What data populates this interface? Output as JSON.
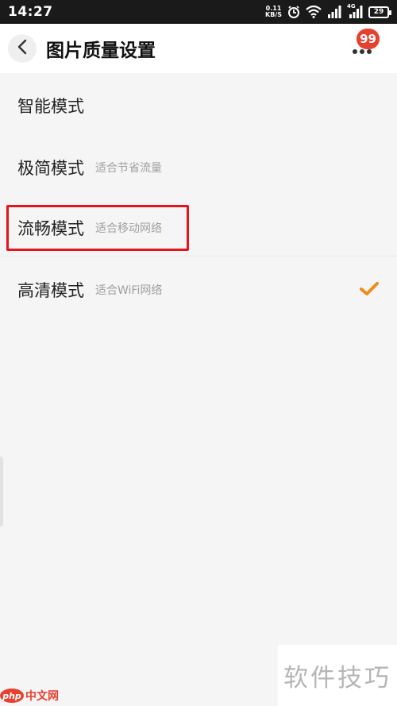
{
  "status_bar": {
    "time": "14:27",
    "net_speed_value": "0.11",
    "net_speed_unit": "KB/S",
    "network_type": "4G",
    "battery": "29"
  },
  "header": {
    "title": "图片质量设置",
    "badge_count": "99"
  },
  "options": [
    {
      "name": "智能模式",
      "desc": "",
      "selected": false
    },
    {
      "name": "极简模式",
      "desc": "适合节省流量",
      "selected": false
    },
    {
      "name": "流畅模式",
      "desc": "适合移动网络",
      "selected": false,
      "highlighted": true
    },
    {
      "name": "高清模式",
      "desc": "适合WiFi网络",
      "selected": true
    }
  ],
  "colors": {
    "accent_check": "#f08a1c",
    "highlight_border": "#e5151b",
    "badge": "#e8402f"
  },
  "watermark": {
    "text": "软件技巧",
    "logo_mark": "php",
    "logo_text": "中文网"
  }
}
